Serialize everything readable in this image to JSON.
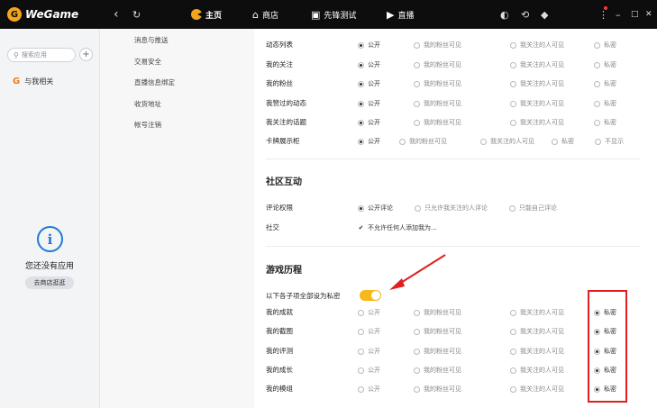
{
  "app": {
    "name": "WeGame",
    "logo_glyph": "G"
  },
  "nav": {
    "back": "‹",
    "refresh": "↻",
    "items": [
      {
        "label": "主页",
        "active": true
      },
      {
        "label": "商店"
      },
      {
        "label": "先锋测试"
      },
      {
        "label": "直播"
      }
    ]
  },
  "topbar_icons": {
    "mode": "◐",
    "ring": "⟲",
    "shield": "◆",
    "menu": "⋮",
    "min": "–",
    "max": "□",
    "close": "✕"
  },
  "sidebar": {
    "search_placeholder": "搜索应用",
    "add": "+",
    "related": "与我相关",
    "related_glyph": "G",
    "empty_icon": "i",
    "empty_text": "您还没有应用",
    "shop_button": "去商店逛逛"
  },
  "menu": [
    "消息与推送",
    "交易安全",
    "直播信息绑定",
    "收货地址",
    "帐号注销"
  ],
  "privacy_rows": [
    {
      "label": "动态列表",
      "opts": [
        "公开",
        "我的粉丝可见",
        "我关注的人可见",
        "私密"
      ]
    },
    {
      "label": "我的关注",
      "opts": [
        "公开",
        "我的粉丝可见",
        "我关注的人可见",
        "私密"
      ]
    },
    {
      "label": "我的粉丝",
      "opts": [
        "公开",
        "我的粉丝可见",
        "我关注的人可见",
        "私密"
      ]
    },
    {
      "label": "我赞过的动态",
      "opts": [
        "公开",
        "我的粉丝可见",
        "我关注的人可见",
        "私密"
      ]
    },
    {
      "label": "我关注的话题",
      "opts": [
        "公开",
        "我的粉丝可见",
        "我关注的人可见",
        "私密"
      ]
    }
  ],
  "card_row": {
    "label": "卡牌展示柜",
    "opts": [
      "公开",
      "我的粉丝可见",
      "我关注的人可见",
      "私密",
      "不显示"
    ]
  },
  "community": {
    "title": "社区互动",
    "comment_label": "评论权限",
    "comment_opts": [
      "公开评论",
      "只允许我关注的人评论",
      "只能自己评论"
    ],
    "social_label": "社交",
    "social_check": "不允许任何人添加我为..."
  },
  "history": {
    "title": "游戏历程",
    "toggle_label": "以下各子项全部设为私密",
    "toggle_on": true,
    "rows": [
      {
        "label": "我的成就",
        "opts": [
          "公开",
          "我的粉丝可见",
          "我关注的人可见",
          "私密"
        ]
      },
      {
        "label": "我的截图",
        "opts": [
          "公开",
          "我的粉丝可见",
          "我关注的人可见",
          "私密"
        ]
      },
      {
        "label": "我的评测",
        "opts": [
          "公开",
          "我的粉丝可见",
          "我关注的人可见",
          "私密"
        ]
      },
      {
        "label": "我的成长",
        "opts": [
          "公开",
          "我的粉丝可见",
          "我关注的人可见",
          "私密"
        ]
      },
      {
        "label": "我的模组",
        "opts": [
          "公开",
          "我的粉丝可见",
          "我关注的人可见",
          "私密"
        ]
      }
    ]
  },
  "colors": {
    "accent": "#f6b81a",
    "highlight": "#e02020",
    "topbar": "#0d0d0d",
    "info": "#1f7ad6"
  }
}
